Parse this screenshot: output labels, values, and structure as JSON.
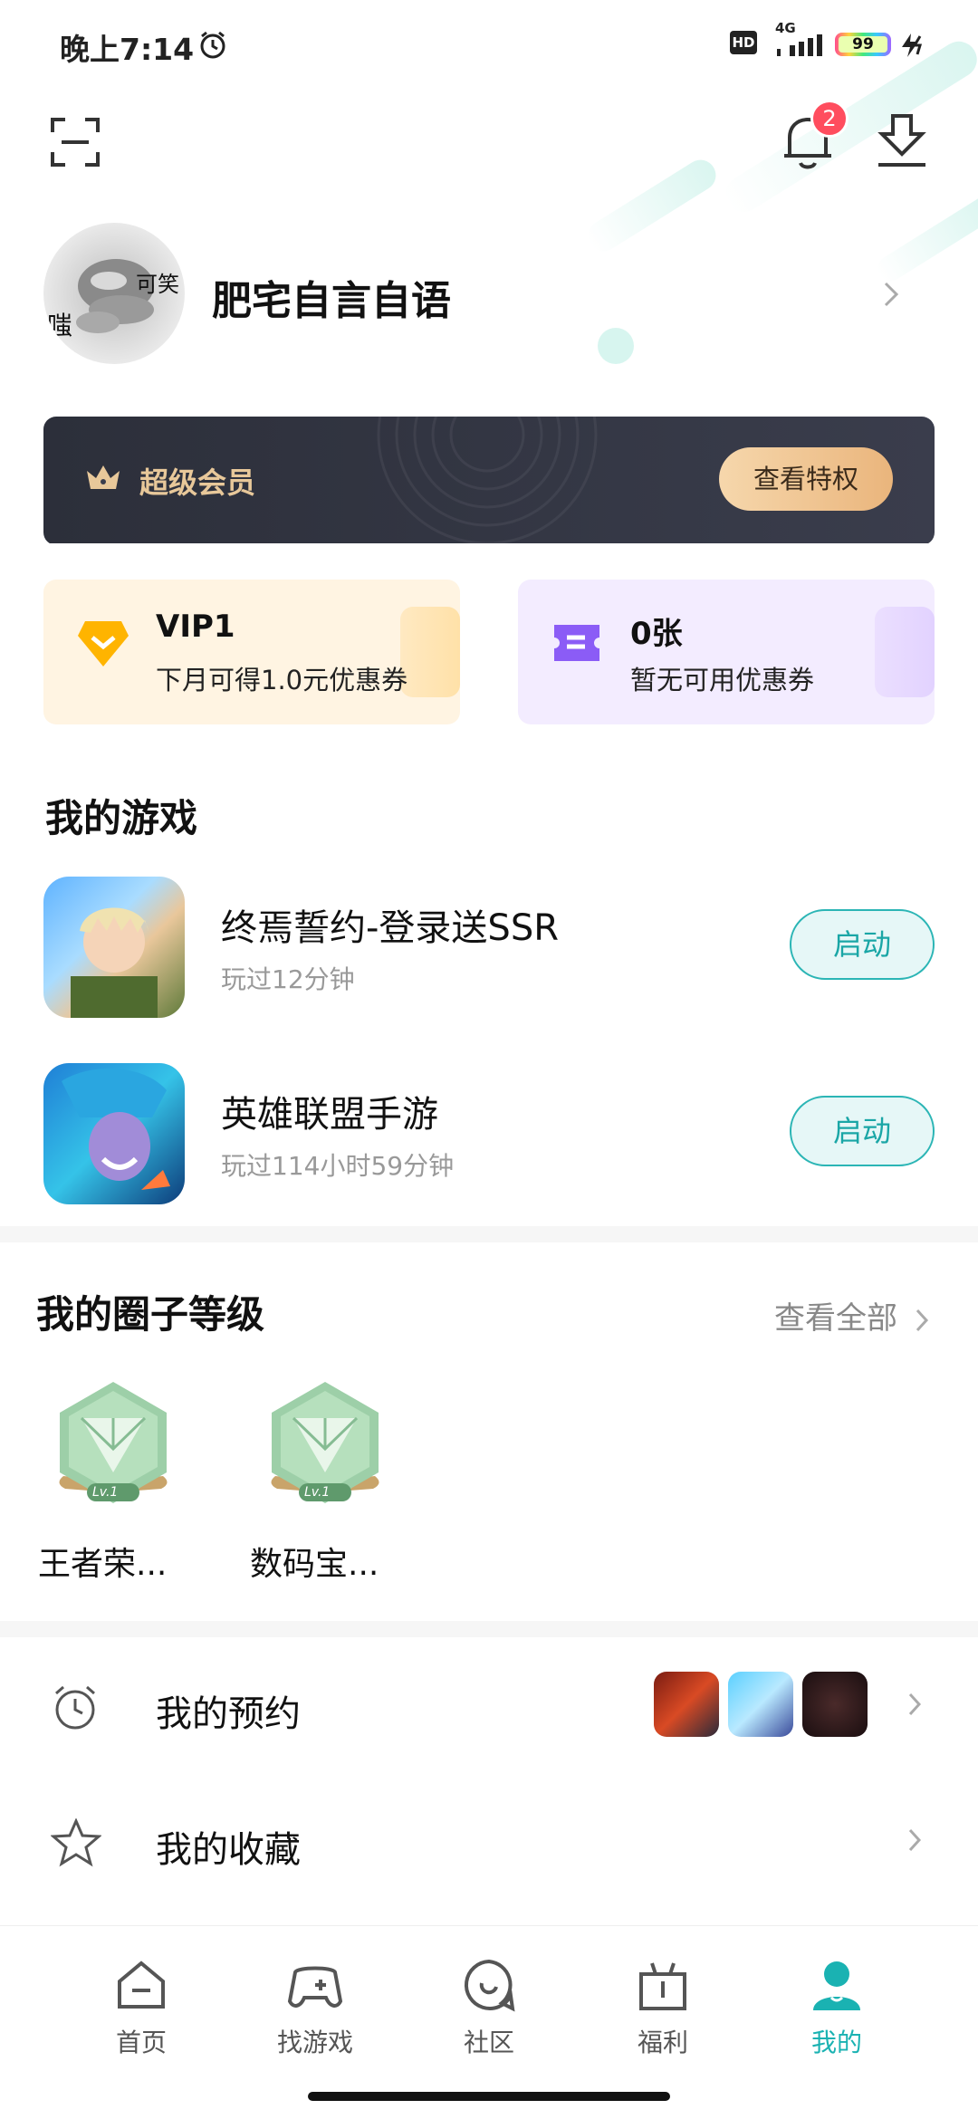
{
  "status_bar": {
    "time": "晚上7:14",
    "hd": "HD",
    "network": "4G",
    "battery": "99"
  },
  "header": {
    "notification_count": "2"
  },
  "profile": {
    "username": "肥宅自言自语",
    "avatar_text_1": "可笑",
    "avatar_text_2": "嗤"
  },
  "vip": {
    "title": "超级会员",
    "button_label": "查看特权"
  },
  "coupons": [
    {
      "title": "VIP1",
      "subtitle": "下月可得1.0元优惠券"
    },
    {
      "title": "0张",
      "subtitle": "暂无可用优惠券"
    }
  ],
  "my_games": {
    "title": "我的游戏",
    "items": [
      {
        "name": "终焉誓约-登录送SSR",
        "played": "玩过12分钟",
        "button": "启动"
      },
      {
        "name": "英雄联盟手游",
        "played": "玩过114小时59分钟",
        "button": "启动"
      }
    ]
  },
  "circle_levels": {
    "title": "我的圈子等级",
    "view_all": "查看全部",
    "items": [
      {
        "label": "王者荣...",
        "level": "Lv.1"
      },
      {
        "label": "数码宝...",
        "level": "Lv.1"
      }
    ]
  },
  "rows": [
    {
      "label": "我的预约"
    },
    {
      "label": "我的收藏"
    }
  ],
  "bottom_nav": [
    {
      "label": "首页"
    },
    {
      "label": "找游戏"
    },
    {
      "label": "社区"
    },
    {
      "label": "福利"
    },
    {
      "label": "我的"
    }
  ],
  "colors": {
    "accent": "#1ab2b2",
    "badge_red": "#ff4d5e",
    "vip_gold": "#e8c89a"
  }
}
